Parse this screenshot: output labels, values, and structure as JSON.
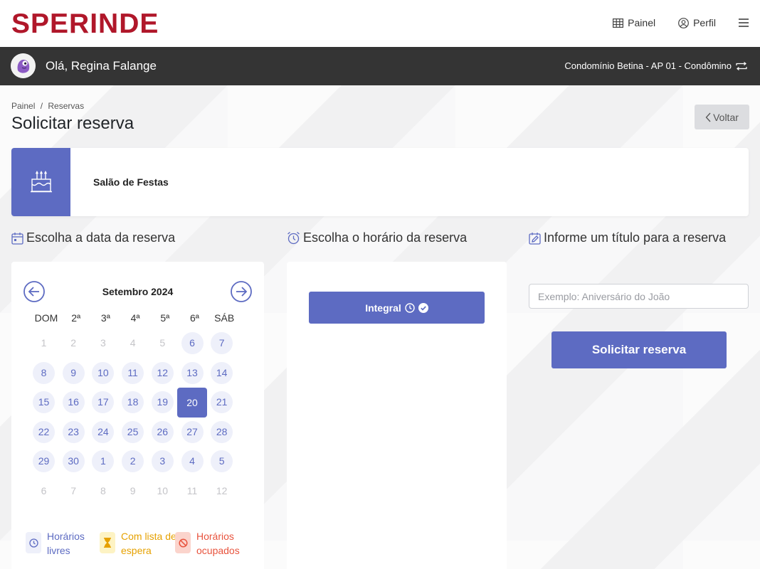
{
  "brand": {
    "logo_text": "SPERINDE",
    "color": "#b0172a"
  },
  "topnav": {
    "painel_label": "Painel",
    "perfil_label": "Perfil",
    "icons": [
      "grid-icon",
      "user-circle-icon",
      "hamburger-menu-icon"
    ]
  },
  "userbar": {
    "greeting": "Olá, Regina Falange",
    "condo": "Condomínio Betina - AP 01 - Condômino"
  },
  "breadcrumb": {
    "home": "Painel",
    "separator": "/",
    "current": "Reservas"
  },
  "page": {
    "title": "Solicitar reserva",
    "back_label": "Voltar"
  },
  "space": {
    "name": "Salão de Festas",
    "icon": "cake-icon",
    "accent": "#5d6bc2"
  },
  "sections": {
    "date": "Escolha a data da reserva",
    "time": "Escolha o horário da reserva",
    "title": "Informe um título para a reserva"
  },
  "calendar": {
    "month_label": "Setembro 2024",
    "weekdays": [
      "DOM",
      "2ª",
      "3ª",
      "4ª",
      "5ª",
      "6ª",
      "SÁB"
    ],
    "selected_day": "20",
    "weeks": [
      [
        {
          "d": "1",
          "s": "muted"
        },
        {
          "d": "2",
          "s": "muted"
        },
        {
          "d": "3",
          "s": "muted"
        },
        {
          "d": "4",
          "s": "muted"
        },
        {
          "d": "5",
          "s": "muted"
        },
        {
          "d": "6",
          "s": "free"
        },
        {
          "d": "7",
          "s": "free"
        }
      ],
      [
        {
          "d": "8",
          "s": "free"
        },
        {
          "d": "9",
          "s": "free"
        },
        {
          "d": "10",
          "s": "free"
        },
        {
          "d": "11",
          "s": "free"
        },
        {
          "d": "12",
          "s": "free"
        },
        {
          "d": "13",
          "s": "free"
        },
        {
          "d": "14",
          "s": "free"
        }
      ],
      [
        {
          "d": "15",
          "s": "free"
        },
        {
          "d": "16",
          "s": "free"
        },
        {
          "d": "17",
          "s": "free"
        },
        {
          "d": "18",
          "s": "free"
        },
        {
          "d": "19",
          "s": "free"
        },
        {
          "d": "20",
          "s": "selected"
        },
        {
          "d": "21",
          "s": "free"
        }
      ],
      [
        {
          "d": "22",
          "s": "free"
        },
        {
          "d": "23",
          "s": "free"
        },
        {
          "d": "24",
          "s": "free"
        },
        {
          "d": "25",
          "s": "free"
        },
        {
          "d": "26",
          "s": "free"
        },
        {
          "d": "27",
          "s": "free"
        },
        {
          "d": "28",
          "s": "free"
        }
      ],
      [
        {
          "d": "29",
          "s": "free"
        },
        {
          "d": "30",
          "s": "free"
        },
        {
          "d": "1",
          "s": "free"
        },
        {
          "d": "2",
          "s": "free"
        },
        {
          "d": "3",
          "s": "free"
        },
        {
          "d": "4",
          "s": "free"
        },
        {
          "d": "5",
          "s": "free"
        }
      ],
      [
        {
          "d": "6",
          "s": "muted"
        },
        {
          "d": "7",
          "s": "muted"
        },
        {
          "d": "8",
          "s": "muted"
        },
        {
          "d": "9",
          "s": "muted"
        },
        {
          "d": "10",
          "s": "muted"
        },
        {
          "d": "11",
          "s": "muted"
        },
        {
          "d": "12",
          "s": "muted"
        }
      ]
    ]
  },
  "legend": {
    "free": {
      "line1": "Horários",
      "line2": "livres",
      "color": "#5d6bc2",
      "bg": "#eef0fa"
    },
    "waitlist": {
      "line1": "Com lista de",
      "line2": "espera",
      "color": "#e6a100",
      "bg": "#fdf3c4"
    },
    "busy": {
      "line1": "Horários",
      "line2": "ocupados",
      "color": "#e8533d",
      "bg": "#fbd4cc"
    }
  },
  "time_slot": {
    "label": "Integral"
  },
  "title_input": {
    "placeholder": "Exemplo: Aniversário do João",
    "value": ""
  },
  "submit": {
    "label": "Solicitar reserva"
  }
}
